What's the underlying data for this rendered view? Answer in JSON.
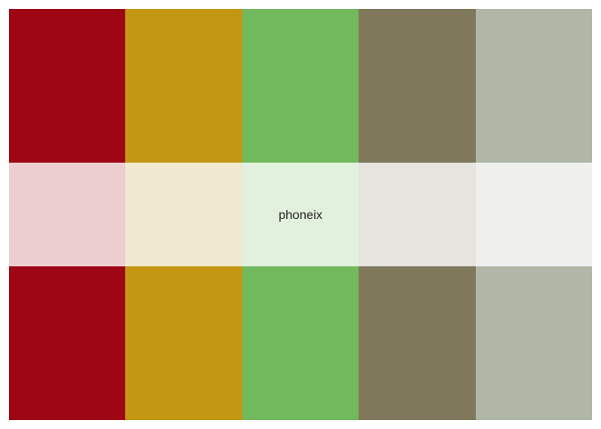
{
  "palette": {
    "name": "phoneix",
    "colors": [
      "#9e0515",
      "#c39711",
      "#72b95e",
      "#7f785b",
      "#b0b7a7"
    ],
    "tints": [
      "#ecced1",
      "#f0e9d0",
      "#e2f0de",
      "#e5e4df",
      "#eff0ee"
    ]
  }
}
